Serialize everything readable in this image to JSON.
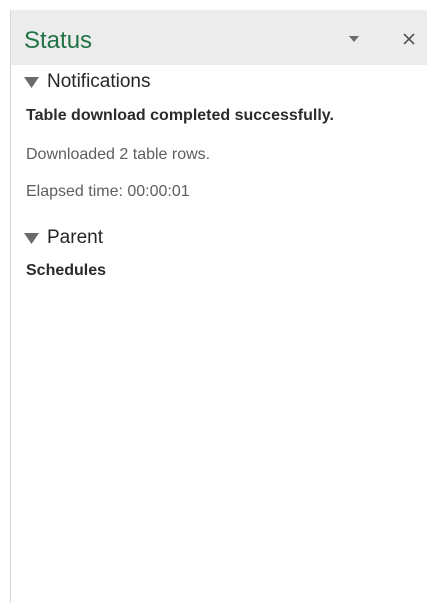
{
  "pane": {
    "title": "Status",
    "options_icon": "caret-down-icon",
    "close_icon": "close-icon"
  },
  "notifications": {
    "label": "Notifications",
    "message": "Table download completed successfully.",
    "rows_text": "Downloaded 2 table rows.",
    "elapsed_text": "Elapsed time: 00:00:01"
  },
  "parent": {
    "label": "Parent",
    "value": "Schedules"
  },
  "colors": {
    "title": "#217346",
    "header_bg": "#ececec"
  }
}
